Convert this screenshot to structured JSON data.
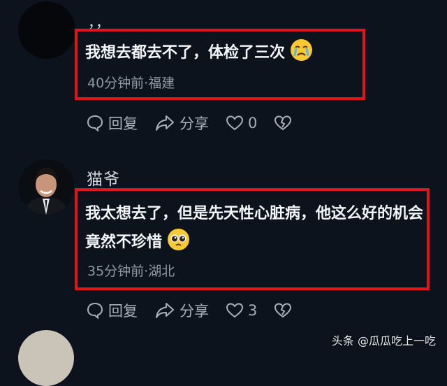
{
  "comments": [
    {
      "username": "，，",
      "text": "我想去都去不了，体检了三次",
      "emoji": "crying-face",
      "meta": "40分钟前·福建",
      "reply_label": "回复",
      "share_label": "分享",
      "like_count": "0"
    },
    {
      "username": "猫爷",
      "text": "我太想去了，但是先天性心脏病，他这么好的机会竟然不珍惜",
      "emoji": "pleading-face",
      "meta": "35分钟前·湖北",
      "reply_label": "回复",
      "share_label": "分享",
      "like_count": "3"
    }
  ],
  "watermark": "头条 @瓜瓜吃上一吃",
  "colors": {
    "background": "#0d131c",
    "highlight_border": "#e0141a",
    "meta_text": "#8f97a3"
  }
}
